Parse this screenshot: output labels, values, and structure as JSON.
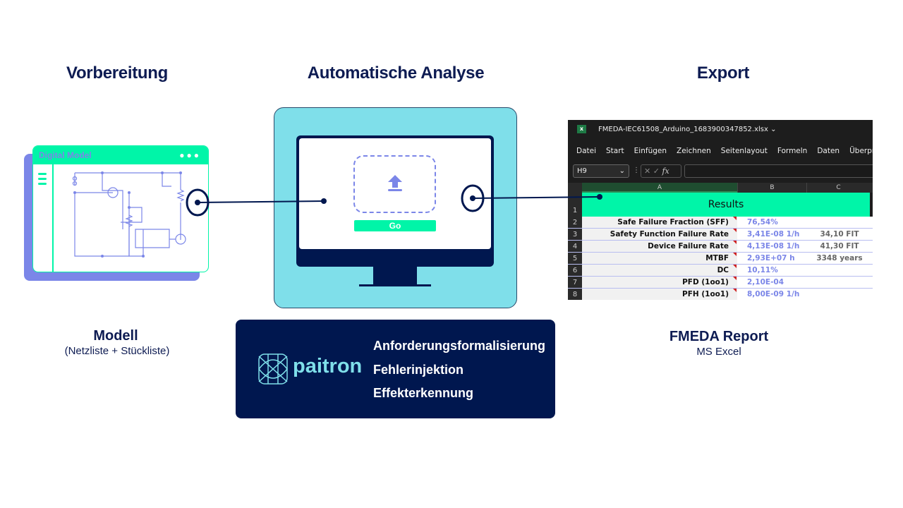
{
  "headings": {
    "left": "Vorbereitung",
    "center": "Automatische Analyse",
    "right": "Export"
  },
  "model_window": {
    "title": "Digital Model"
  },
  "monitor": {
    "go_label": "Go"
  },
  "left_caption": {
    "title": "Modell",
    "subtitle": "(Netzliste + Stückliste)"
  },
  "right_caption": {
    "title": "FMEDA Report",
    "subtitle": "MS Excel"
  },
  "paitron": {
    "logo_text": "paitron",
    "features": [
      "Anforderungsformalisierung",
      "Fehlerinjektion",
      "Effekterkennung"
    ]
  },
  "excel": {
    "filename": "FMEDA-IEC61508_Arduino_1683900347852.xlsx",
    "menu": [
      "Datei",
      "Start",
      "Einfügen",
      "Zeichnen",
      "Seitenlayout",
      "Formeln",
      "Daten",
      "Überprüfen"
    ],
    "name_box": "H9",
    "columns": [
      "A",
      "B",
      "C"
    ],
    "results_title": "Results",
    "rows": [
      {
        "n": "2",
        "label": "Safe Failure Fraction (SFF)",
        "value": "76,54%",
        "extra": ""
      },
      {
        "n": "3",
        "label": "Safety Function Failure Rate",
        "value": "3,41E-08  1/h",
        "extra": "34,10 FIT"
      },
      {
        "n": "4",
        "label": "Device Failure Rate",
        "value": "4,13E-08  1/h",
        "extra": "41,30 FIT"
      },
      {
        "n": "5",
        "label": "MTBF",
        "value": "2,93E+07  h",
        "extra": "3348 years"
      },
      {
        "n": "6",
        "label": "DC",
        "value": "10,11%",
        "extra": ""
      },
      {
        "n": "7",
        "label": "PFD (1oo1)",
        "value": "2,10E-04",
        "extra": ""
      },
      {
        "n": "8",
        "label": "PFH (1oo1)",
        "value": "8,00E-09  1/h",
        "extra": ""
      }
    ]
  },
  "colors": {
    "navy": "#00174f",
    "green": "#00f5a8",
    "cyan": "#7fdfea",
    "purple": "#7b86e8"
  }
}
